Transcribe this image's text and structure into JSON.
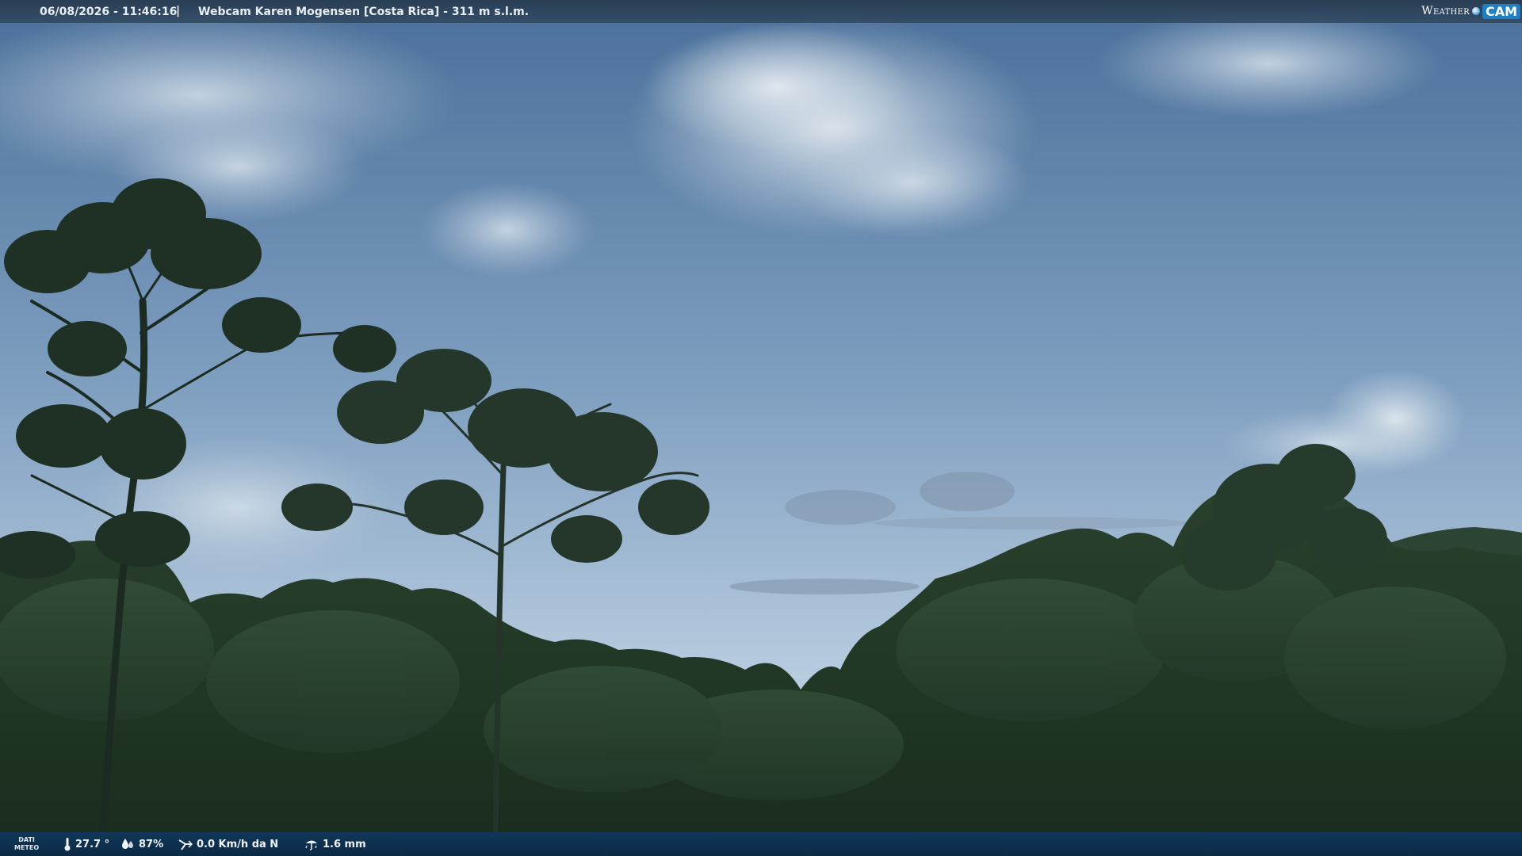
{
  "header": {
    "datetime": "06/08/2026 - 11:46:16",
    "separator": "|",
    "title": "Webcam Karen Mogensen [Costa Rica] - 311 m s.l.m."
  },
  "logo": {
    "word1": "Weather",
    "word2": "CAM"
  },
  "footer": {
    "label_line1": "DATI",
    "label_line2": "METEO",
    "temperature": "27.7 °",
    "humidity": "87%",
    "wind": "0.0 Km/h da N",
    "rain": "1.6 mm"
  },
  "icons": {
    "temperature": "thermometer-icon",
    "humidity": "humidity-drops-icon",
    "wind": "wind-icon",
    "rain": "rain-icon"
  },
  "colors": {
    "sky_top": "#4a6f9a",
    "sky_bottom": "#b9cde0",
    "foliage": "#1f3322",
    "bar": "#1a3c5e"
  }
}
